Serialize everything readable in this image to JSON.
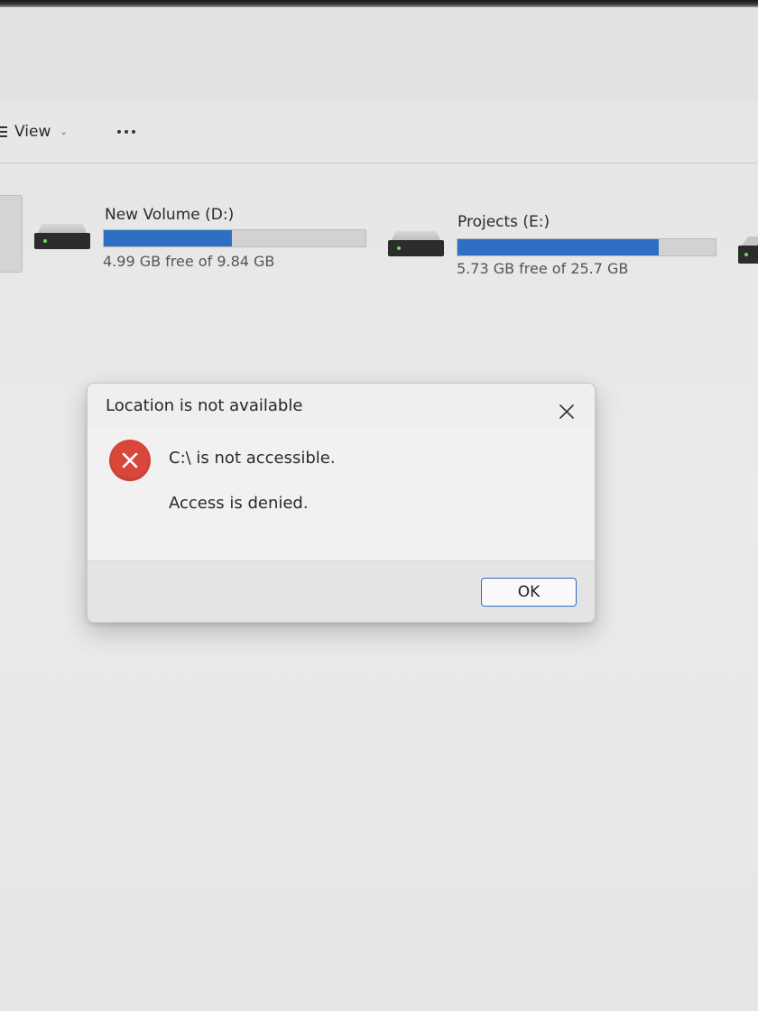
{
  "toolbar": {
    "view_label": "View",
    "view_icon": "list-view-icon",
    "more_icon": "more-options-icon"
  },
  "drives": [
    {
      "label": "New Volume (D:)",
      "free_text": "4.99 GB free of 9.84 GB",
      "used_fraction": 0.49
    },
    {
      "label": "Projects (E:)",
      "free_text": "5.73 GB free of 25.7 GB",
      "used_fraction": 0.78
    }
  ],
  "dialog": {
    "title": "Location is not available",
    "message": "C:\\ is not accessible.",
    "detail": "Access is denied.",
    "ok_label": "OK",
    "icon": "error-icon",
    "close_icon": "close-icon"
  },
  "colors": {
    "accent": "#2f6fc3",
    "error": "#d9463a"
  }
}
